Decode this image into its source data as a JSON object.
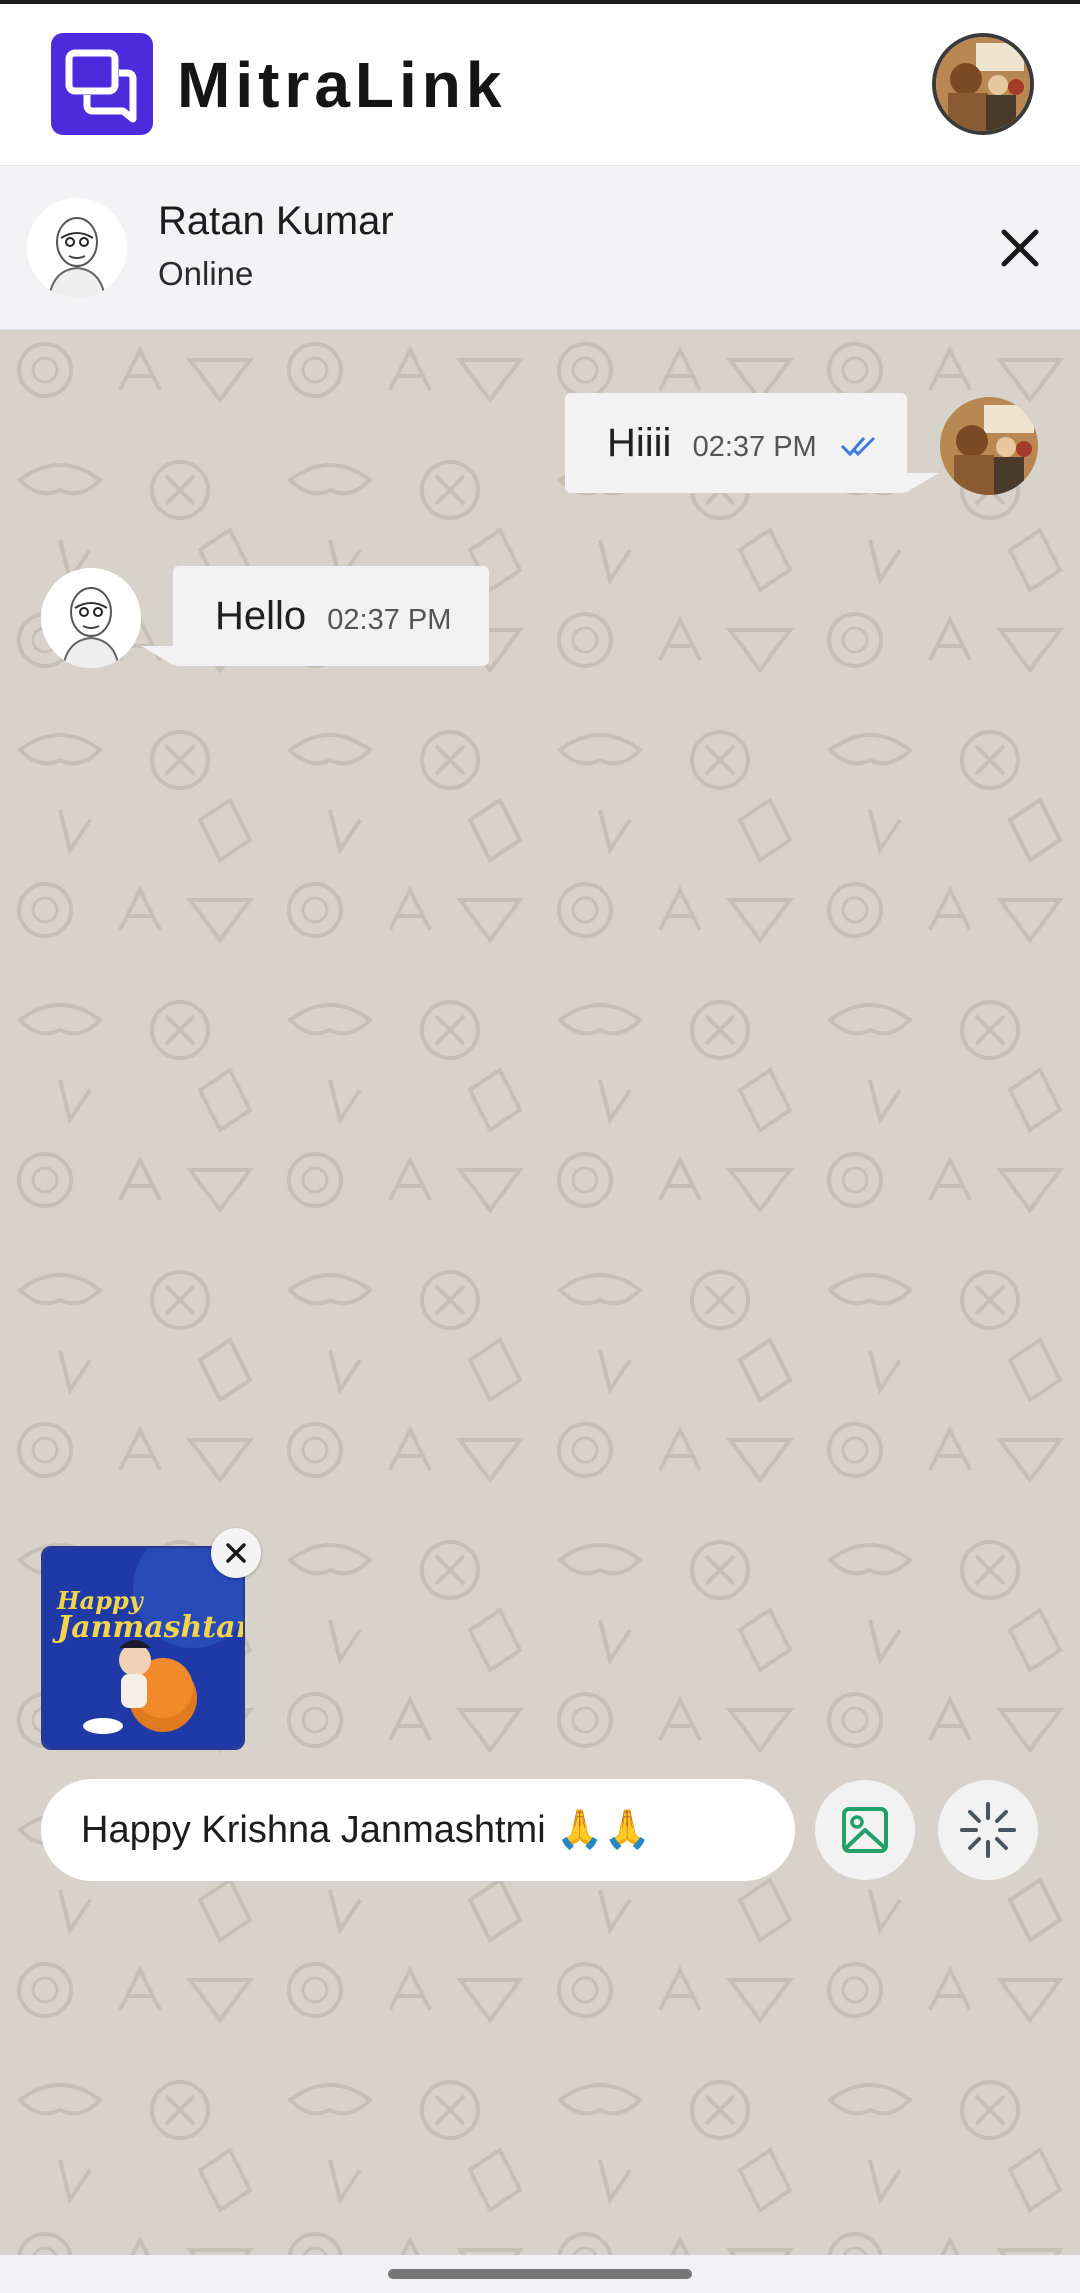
{
  "app": {
    "name": "MitraLink",
    "logo_icon": "chat-bubbles-icon",
    "brand_color": "#4b2bdc"
  },
  "chat": {
    "contact_name": "Ratan Kumar",
    "contact_status": "Online"
  },
  "messages": [
    {
      "direction": "outgoing",
      "text": "Hiiii",
      "time": "02:37 PM",
      "status": "read",
      "status_icon": "double-check-icon",
      "status_color": "#3b7be0"
    },
    {
      "direction": "incoming",
      "text": "Hello",
      "time": "02:37 PM"
    }
  ],
  "attachment": {
    "caption_line1": "Happy",
    "caption_line2": "Janmashtami"
  },
  "composer": {
    "value": "Happy Krishna Janmashtmi 🙏🙏"
  },
  "icons": {
    "close": "close-icon",
    "image": "image-icon",
    "ai": "sparkle-icon",
    "image_color": "#22a06b"
  }
}
